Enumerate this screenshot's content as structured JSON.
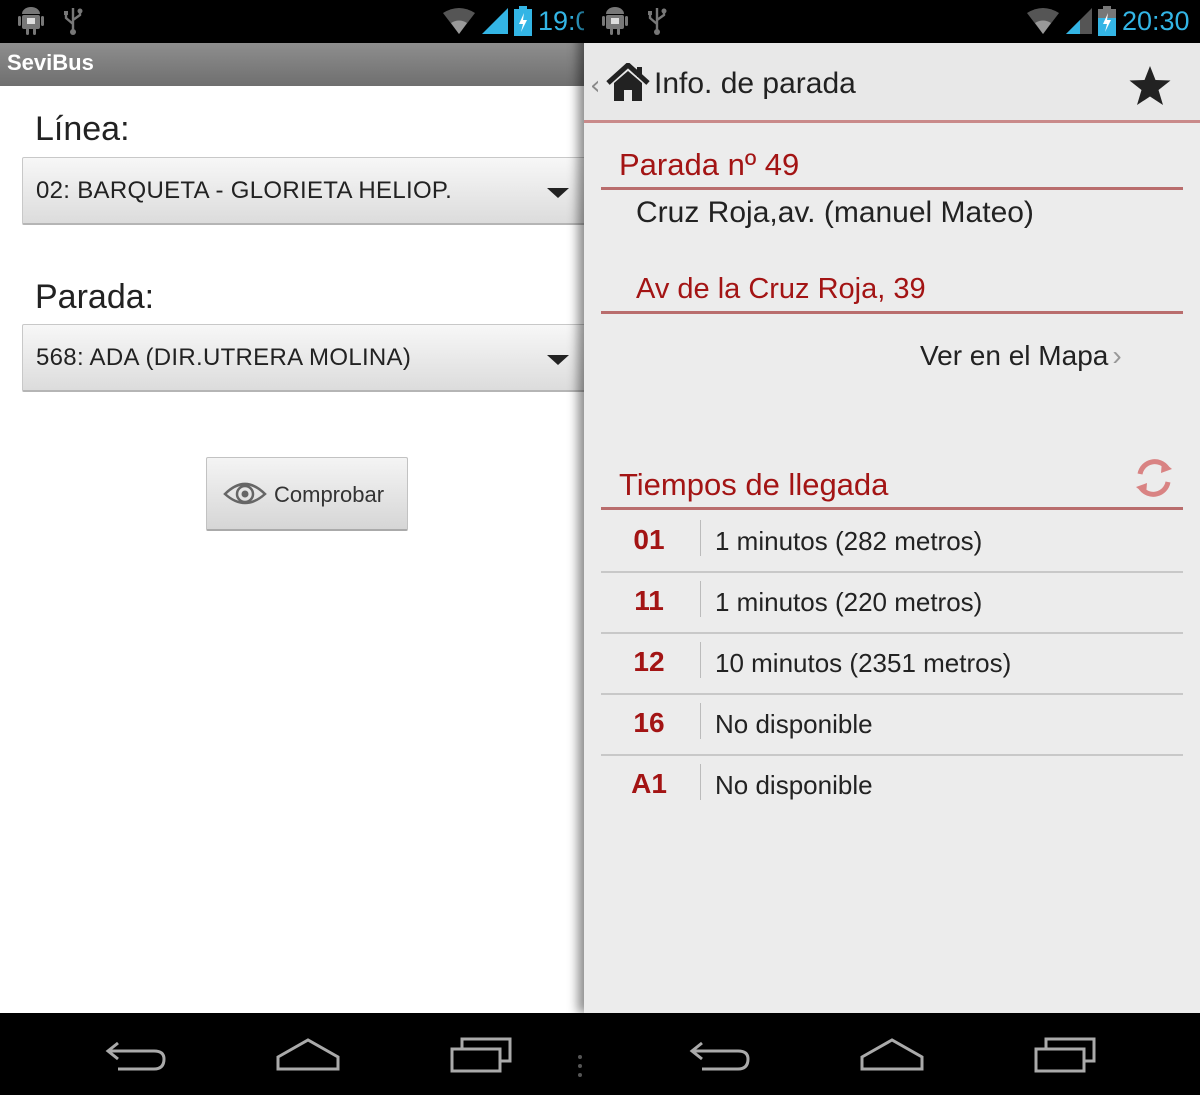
{
  "left": {
    "status": {
      "clock": "19:0"
    },
    "app_title": "SeviBus",
    "linea_label": "Línea:",
    "linea_value": "02: BARQUETA - GLORIETA HELIOP.",
    "parada_label": "Parada:",
    "parada_value": "568: ADA (DIR.UTRERA MOLINA)",
    "check_button": "Comprobar"
  },
  "right": {
    "status": {
      "clock": "20:30"
    },
    "title": "Info. de parada",
    "stop_number": "Parada nº 49",
    "stop_name": "Cruz Roja,av. (manuel Mateo)",
    "address": "Av de la Cruz Roja, 39",
    "map_link": "Ver en el Mapa",
    "arrivals_header": "Tiempos de llegada",
    "arrivals": [
      {
        "line": "01",
        "time": "1 minutos (282 metros)"
      },
      {
        "line": "11",
        "time": "1 minutos (220 metros)"
      },
      {
        "line": "12",
        "time": "10 minutos (2351 metros)"
      },
      {
        "line": "16",
        "time": "No disponible"
      },
      {
        "line": "A1",
        "time": "No disponible"
      }
    ]
  },
  "colors": {
    "accent": "#a31414",
    "divider": "#b96d6d",
    "clock": "#33b5e5"
  },
  "icons": [
    "android-icon",
    "usb-icon",
    "wifi-icon",
    "signal-icon",
    "battery-icon",
    "home-icon",
    "star-icon",
    "refresh-icon",
    "eye-icon",
    "back-icon",
    "recents-icon"
  ]
}
